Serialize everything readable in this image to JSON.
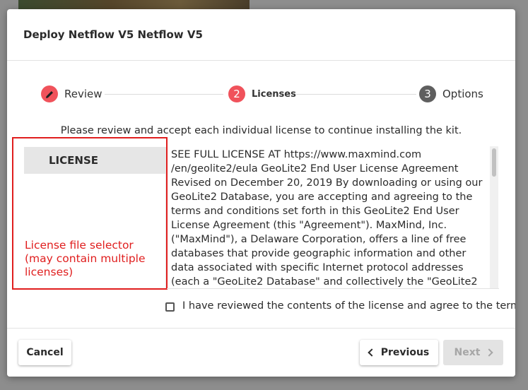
{
  "modal": {
    "title": "Deploy Netflow V5 Netflow V5"
  },
  "stepper": {
    "steps": [
      {
        "number": "",
        "label": "Review",
        "icon": "pencil-icon",
        "state": "completed",
        "color": "#f0525b"
      },
      {
        "number": "2",
        "label": "Licenses",
        "state": "active",
        "color": "#f0525b"
      },
      {
        "number": "3",
        "label": "Options",
        "state": "inactive",
        "color": "#5f5f5f"
      }
    ]
  },
  "instruction": "Please review and accept each individual license to continue installing the kit.",
  "license_list": {
    "items": [
      {
        "label": "LICENSE",
        "selected": true
      }
    ]
  },
  "annotation": {
    "text": "License file selector (may contain multiple licenses)",
    "color": "#e01e1e"
  },
  "license_text": "SEE FULL LICENSE AT https://www.maxmind.com /en/geolite2/eula GeoLite2 End User License Agreement Revised on December 20, 2019 By downloading or using our GeoLite2 Database, you are accepting and agreeing to the terms and conditions set forth in this GeoLite2 End User License Agreement (this \"Agreement\"). MaxMind, Inc. (\"MaxMind\"), a Delaware Corporation, offers a line of free databases that provide geographic information and other data associated with specific Internet protocol addresses (each a \"GeoLite2 Database\" and collectively the \"GeoLite2",
  "agree": {
    "label": "I have reviewed the contents of the license and agree to the terms",
    "checked": false
  },
  "footer": {
    "cancel_label": "Cancel",
    "previous_label": "Previous",
    "next_label": "Next"
  }
}
